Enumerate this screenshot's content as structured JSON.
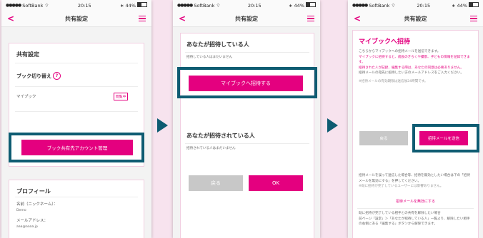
{
  "status": {
    "carrier": "SoftBank",
    "time": "20:15",
    "battery": "44%"
  },
  "screen1": {
    "title": "共有設定",
    "section_title": "共有設定",
    "switch_label": "ブック切り替え",
    "help": "?",
    "mybook_label": "マイブック",
    "mybook_badge": "閲覧中",
    "manage_button": "ブック共有先アカウント管理",
    "profile_title": "プロフィール",
    "name_label": "名前（ニックネーム）：",
    "name_value": "Demo",
    "email_label": "メールアドレス：",
    "email_value": "aaa@aaaa.jp"
  },
  "screen2": {
    "title": "共有設定",
    "inviting_title": "あなたが招待している人",
    "inviting_empty": "招待している人はまだいません",
    "invite_button": "マイブックへ招待する",
    "invited_title": "あなたが招待されている人",
    "invited_empty": "招待されている人はまだいません",
    "back_button": "戻る",
    "ok_button": "OK"
  },
  "screen3": {
    "title": "共有設定",
    "heading": "マイブックへ招待",
    "desc_1": "こちらからマイブックへの招待メールを送信できます。",
    "desc_2": "マイブックに招待すると、成長のきろくや撮景、子どもの情報を記録できます。",
    "desc_3": "招待された人が記録、編集する際は、あなたの同意は必要ありません。",
    "desc_4": "招待メールの宛先に招待したい方のメールアドレスをご入力ください。",
    "note_1": "※招待メールの有効期限は送信後24時間です。",
    "back_button": "戻る",
    "send_button": "招待メールを送信",
    "after_1": "招待メールを誤って送信した場合等、招待を無効としたい場合は下の「招待メールを無効にする」を押してください。",
    "after_2": "※既に招待が完了しているユーザーには影響ありません。",
    "invalidate_link": "招待メールを無効にする",
    "footer_1": "既に招待が完了している相手との共有を解除したい場合",
    "footer_2": "前ページ「設定」＞「あなたが招待している人」一覧より、解除したい相手の右側にある「編集する」ボタンから解除できます。"
  }
}
